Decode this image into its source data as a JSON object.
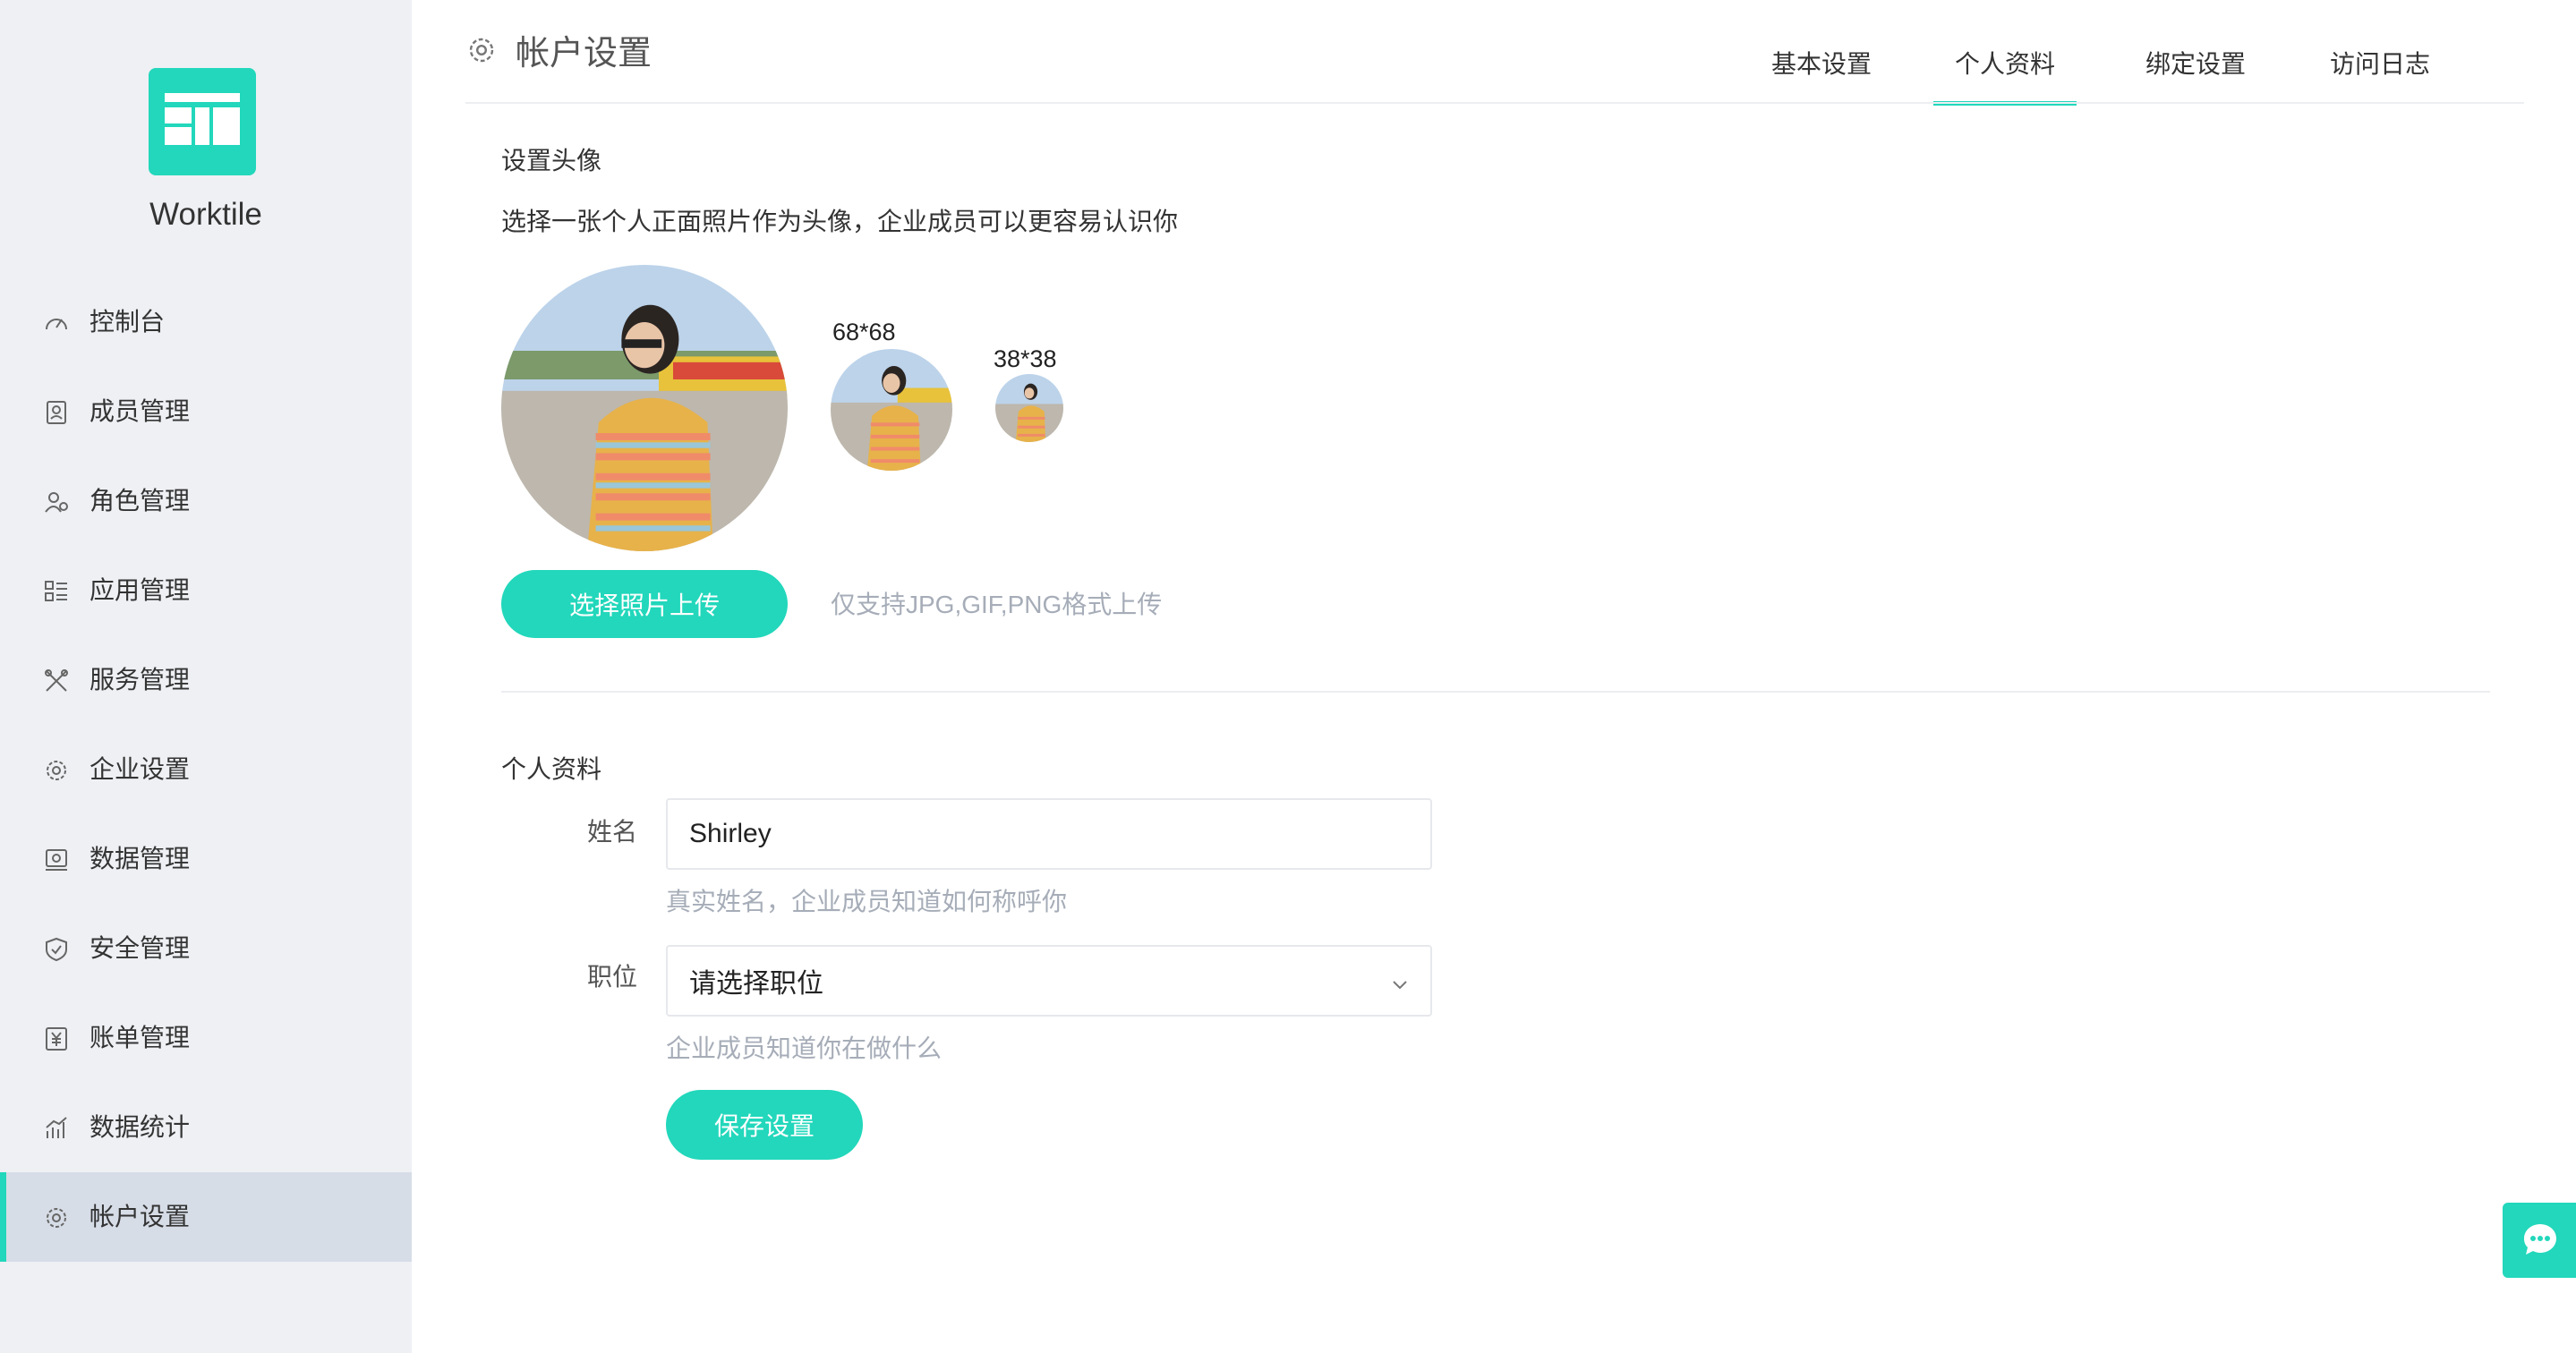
{
  "brand": {
    "name": "Worktile",
    "accent": "#22d7bb"
  },
  "sidebar": {
    "items": [
      {
        "label": "控制台",
        "icon": "dashboard-icon"
      },
      {
        "label": "成员管理",
        "icon": "member-icon"
      },
      {
        "label": "角色管理",
        "icon": "role-icon"
      },
      {
        "label": "应用管理",
        "icon": "apps-icon"
      },
      {
        "label": "服务管理",
        "icon": "tools-icon"
      },
      {
        "label": "企业设置",
        "icon": "gear-icon"
      },
      {
        "label": "数据管理",
        "icon": "data-icon"
      },
      {
        "label": "安全管理",
        "icon": "shield-icon"
      },
      {
        "label": "账单管理",
        "icon": "bill-icon"
      },
      {
        "label": "数据统计",
        "icon": "chart-icon"
      },
      {
        "label": "帐户设置",
        "icon": "gear-icon",
        "active": true
      }
    ]
  },
  "header": {
    "title": "帐户设置",
    "tabs": [
      {
        "label": "基本设置"
      },
      {
        "label": "个人资料",
        "active": true
      },
      {
        "label": "绑定设置"
      },
      {
        "label": "访问日志"
      }
    ]
  },
  "avatar_section": {
    "title": "设置头像",
    "description": "选择一张个人正面照片作为头像，企业成员可以更容易认识你",
    "size_medium": "68*68",
    "size_small": "38*38",
    "upload_button": "选择照片上传",
    "upload_hint": "仅支持JPG,GIF,PNG格式上传"
  },
  "profile_section": {
    "title": "个人资料",
    "name_label": "姓名",
    "name_value": "Shirley",
    "name_help": "真实姓名，企业成员知道如何称呼你",
    "position_label": "职位",
    "position_value": "请选择职位",
    "position_help": "企业成员知道你在做什么",
    "save_button": "保存设置"
  }
}
